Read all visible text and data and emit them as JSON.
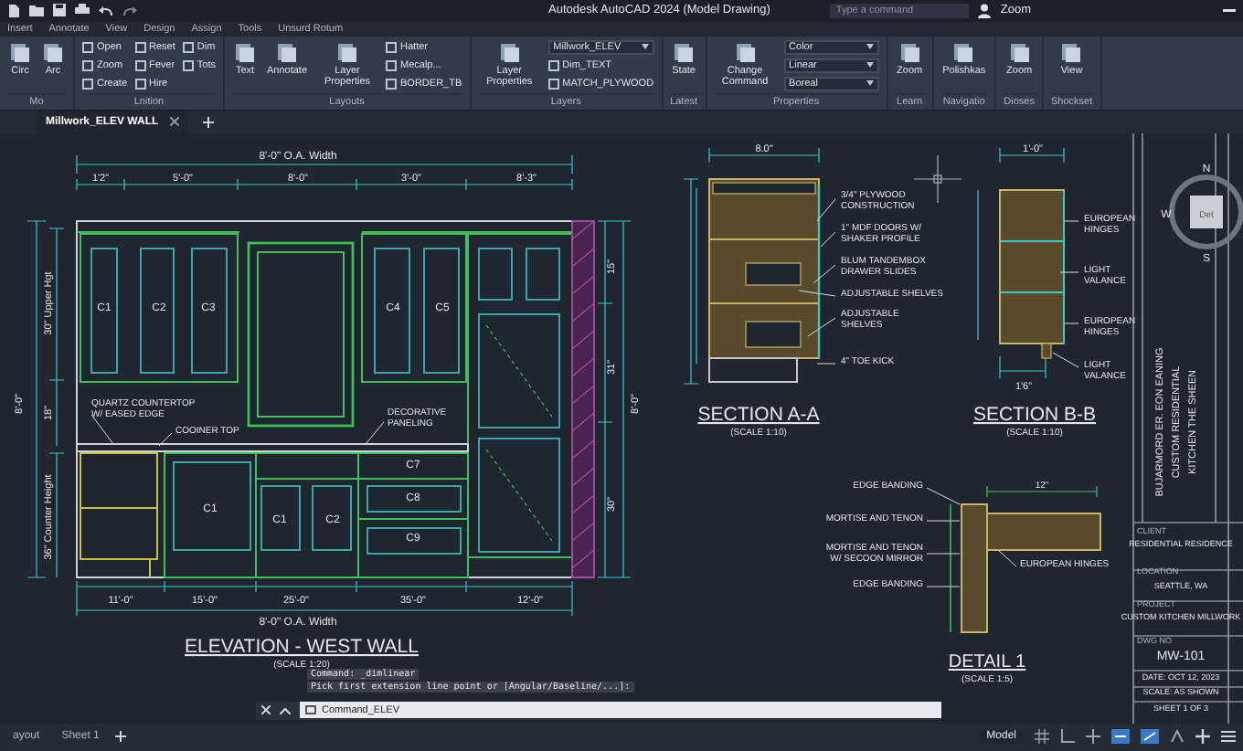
{
  "title_bar": {
    "title": "Autodesk AutoCAD 2024  (Model Drawing)",
    "search_placeholder": "Type a command",
    "user": "Zoom"
  },
  "menu_tabs": [
    {
      "label": "Insert",
      "selected": false
    },
    {
      "label": "Annotate",
      "selected": false
    },
    {
      "label": "View",
      "selected": false
    },
    {
      "label": "Design",
      "selected": false
    },
    {
      "label": "Assign",
      "selected": false
    },
    {
      "label": "Tools",
      "selected": false
    },
    {
      "label": "Unsurd Rotum",
      "selected": false
    }
  ],
  "ribbon": [
    {
      "title": "Mo",
      "tools": [
        {
          "label": "Circ",
          "kind": "large"
        },
        {
          "label": "Arc",
          "kind": "large"
        }
      ]
    },
    {
      "title": "Lnition",
      "tools": [
        {
          "label": "Open",
          "kind": "small"
        },
        {
          "label": "Zoom",
          "kind": "small"
        },
        {
          "label": "Create",
          "kind": "small"
        },
        {
          "label": "Reset",
          "kind": "small"
        },
        {
          "label": "Fever",
          "kind": "small"
        },
        {
          "label": "Hire",
          "kind": "small"
        },
        {
          "label": "Dim",
          "kind": "small"
        },
        {
          "label": "Tots",
          "kind": "small"
        }
      ]
    },
    {
      "title": "Layouts",
      "tools": [
        {
          "label": "Text",
          "kind": "large"
        },
        {
          "label": "Annotate",
          "kind": "large"
        },
        {
          "label": "Layer Properties",
          "kind": "large"
        },
        {
          "label": "Hatter",
          "kind": "small"
        },
        {
          "label": "Mecalp...",
          "kind": "small"
        },
        {
          "label": "BORDER_TB",
          "kind": "small"
        }
      ]
    },
    {
      "title": "Layers",
      "tools": [
        {
          "label": "Layer Properties",
          "kind": "large"
        },
        {
          "label": "Millwork_ELEV",
          "kind": "dropdown"
        },
        {
          "label": "Dim_TEXT",
          "kind": "small"
        },
        {
          "label": "MATCH_PLYWOOD",
          "kind": "small"
        }
      ]
    },
    {
      "title": "Latest",
      "tools": [
        {
          "label": "State",
          "kind": "large"
        }
      ]
    },
    {
      "title": "Properties",
      "tools": [
        {
          "label": "Change Command",
          "kind": "large"
        },
        {
          "label": "Color",
          "kind": "dropdown"
        },
        {
          "label": "Linear",
          "kind": "dropdown"
        },
        {
          "label": "Boreal",
          "kind": "dropdown"
        }
      ]
    },
    {
      "title": "Learn",
      "tools": [
        {
          "label": "Zoom",
          "kind": "large"
        }
      ]
    },
    {
      "title": "Navigatio",
      "tools": [
        {
          "label": "Polishkas",
          "kind": "large"
        }
      ]
    },
    {
      "title": "Dioses",
      "tools": [
        {
          "label": "Zoom",
          "kind": "large"
        }
      ]
    },
    {
      "title": "Shockset",
      "tools": [
        {
          "label": "View",
          "kind": "large"
        }
      ]
    }
  ],
  "doc_tabs": [
    {
      "label": "Millwork_ELEV WALL",
      "selected": true
    }
  ],
  "elevation": {
    "title": "ELEVATION - WEST WALL",
    "scale": "(SCALE 1:20)",
    "top_width": "8'-0\" O.A. Width",
    "bottom_width": "8'-0\" O.A. Width",
    "top_dims": [
      "1'2\"",
      "5'-0\"",
      "8'-0\"",
      "3'-0\"",
      "8'-3\""
    ],
    "bottom_dims": [
      "11'-0\"",
      "15'-0\"",
      "25'-0\"",
      "35'-0\"",
      "12'-0\""
    ],
    "left_dims": [
      "30\" Upper Hgt",
      "18\"",
      "36\" Counter Height",
      "8'-0\""
    ],
    "right_dims": [
      "15\"",
      "31\"",
      "30\"",
      "8'-0\""
    ],
    "upper_labels": [
      "C1",
      "C2",
      "C3",
      "C4",
      "C5"
    ],
    "lower_labels": [
      "C1",
      "C1",
      "C2",
      "C7",
      "C8",
      "C9"
    ],
    "callouts": [
      {
        "lines": [
          "QUARTZ COUNTERTOP",
          "W/ EASED EDGE"
        ]
      },
      {
        "lines": [
          "COOINER TOP"
        ]
      },
      {
        "lines": [
          "DECORATIVE",
          "PANELING"
        ]
      }
    ]
  },
  "section_a": {
    "title": "SECTION A-A",
    "scale": "(SCALE 1:10)",
    "width": "8.0\"",
    "notes": [
      {
        "lines": [
          "3/4\" PLYWOOD",
          "CONSTRUCTION"
        ]
      },
      {
        "lines": [
          "1\" MDF DOORS W/",
          "SHAKER PROFILE"
        ]
      },
      {
        "lines": [
          "BLUM TANDEMBOX",
          "DRAWER SLIDES"
        ]
      },
      {
        "lines": [
          "ADJUSTABLE SHELVES"
        ]
      },
      {
        "lines": [
          "ADJUSTABLE",
          "SHELVES"
        ]
      },
      {
        "lines": [
          "4\" TOE KICK"
        ]
      }
    ]
  },
  "section_b": {
    "title": "SECTION B-B",
    "scale": "(SCALE 1:10)",
    "width": "1'-0\"",
    "bottom_width": "1'6\"",
    "notes": [
      {
        "lines": [
          "EUROPEAN",
          "HINGES"
        ]
      },
      {
        "lines": [
          "LIGHT",
          "VALANCE"
        ]
      },
      {
        "lines": [
          "EUROPEAN",
          "HINGES"
        ]
      },
      {
        "lines": [
          "LIGHT",
          "VALANCE"
        ]
      }
    ]
  },
  "detail": {
    "title": "DETAIL 1",
    "scale": "(SCALE 1:5)",
    "width": "12\"",
    "notes": [
      {
        "lines": [
          "EDGE BANDING"
        ]
      },
      {
        "lines": [
          "MORTISE AND TENON"
        ]
      },
      {
        "lines": [
          "MORTISE AND TENON",
          "W/ SECOON MIRROR"
        ]
      },
      {
        "lines": [
          "EDGE BANDING"
        ]
      },
      {
        "lines": [
          "EUROPEAN HINGES"
        ]
      }
    ]
  },
  "viewcube": {
    "north": "N",
    "west": "W",
    "south": "S",
    "face": "Det"
  },
  "title_block": {
    "vertical": [
      "BUJARMORD ER. EON EANING",
      "CUSTOM RESIDENTIAL",
      "KITCHEN THE SHEEN"
    ],
    "rows": [
      {
        "kind": "label",
        "text": "CLIENT"
      },
      {
        "kind": "value",
        "text": "RESIDENTIAL RESIDENCE"
      },
      {
        "kind": "label",
        "text": "LOCATION"
      },
      {
        "kind": "value",
        "text": "SEATTLE, WA"
      },
      {
        "kind": "label",
        "text": "PROJECT"
      },
      {
        "kind": "value",
        "text": "CUSTOM KITCHEN MILLWORK"
      },
      {
        "kind": "label",
        "text": "DWG NO"
      },
      {
        "kind": "big",
        "text": "MW-101"
      },
      {
        "kind": "value",
        "text": "DATE: OCT 12, 2023"
      },
      {
        "kind": "value",
        "text": "SCALE: AS SHOWN"
      },
      {
        "kind": "value",
        "text": "SHEET 1 OF 3"
      }
    ]
  },
  "command": {
    "history": [
      "Command:  _dimlinear",
      "Pick first extension line point or [Angular/Baseline/...]:"
    ],
    "input": "Command_ELEV"
  },
  "layout_tabs": [
    {
      "label": "ayout",
      "selected": false
    },
    {
      "label": "Sheet 1",
      "selected": false
    }
  ],
  "status": {
    "model": "Model"
  }
}
